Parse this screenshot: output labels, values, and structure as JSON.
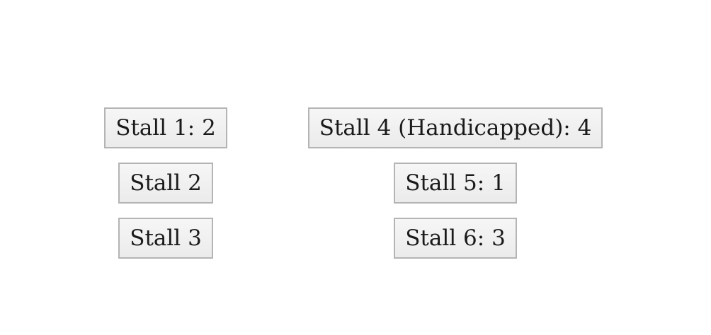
{
  "stalls": [
    {
      "id": 1,
      "label": "Stall 1: 2"
    },
    {
      "id": 2,
      "label": "Stall 2"
    },
    {
      "id": 3,
      "label": "Stall 3"
    },
    {
      "id": 4,
      "label": "Stall 4 (Handicapped): 4"
    },
    {
      "id": 5,
      "label": "Stall 5: 1"
    },
    {
      "id": 6,
      "label": "Stall 6: 3"
    }
  ]
}
